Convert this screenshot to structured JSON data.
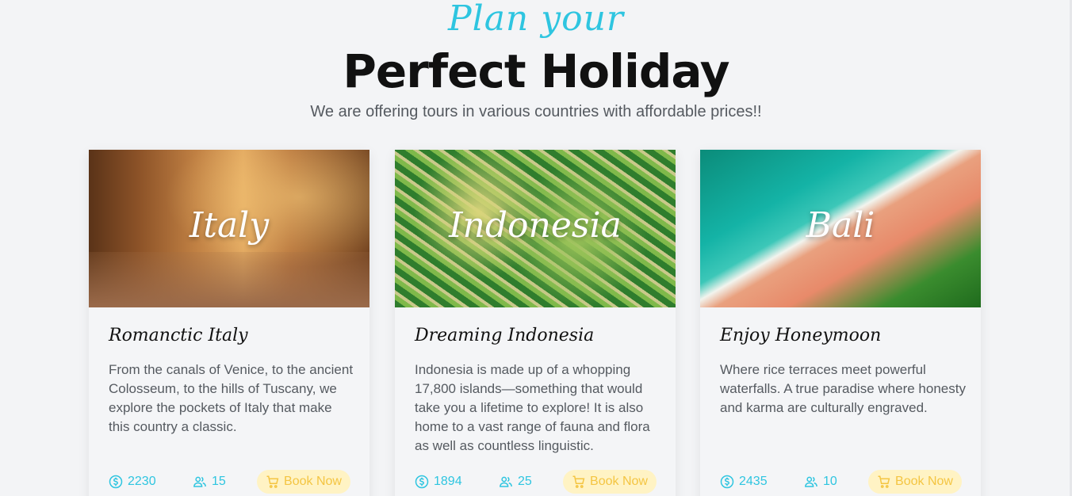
{
  "header": {
    "kicker": "Plan your",
    "title": "Perfect Holiday",
    "subtitle": "We are offering tours in various countries with affordable prices!!"
  },
  "colors": {
    "accent": "#2ec5e0",
    "book_bg": "#fff3c4",
    "book_text": "#f4c542"
  },
  "cards": [
    {
      "image_label": "Italy",
      "title": "Romanctic Italy",
      "description": "From the canals of Venice, to the ancient Colosseum, to the hills of Tuscany, we explore the pockets of Italy that make this country a classic.",
      "price": "2230",
      "people": "15",
      "book_label": "Book Now",
      "price_icon": "dollar-circle-icon",
      "people_icon": "users-icon",
      "book_icon": "cart-icon"
    },
    {
      "image_label": "Indonesia",
      "title": "Dreaming Indonesia",
      "description": "Indonesia is made up of a whopping 17,800 islands—something that would take you a lifetime to explore! It is also home to a vast range of fauna and flora as well as countless linguistic.",
      "price": "1894",
      "people": "25",
      "book_label": "Book Now",
      "price_icon": "dollar-circle-icon",
      "people_icon": "users-icon",
      "book_icon": "cart-icon"
    },
    {
      "image_label": "Bali",
      "title": "Enjoy Honeymoon",
      "description": "Where rice terraces meet powerful waterfalls. A true paradise where honesty and karma are culturally engraved.",
      "price": "2435",
      "people": "10",
      "book_label": "Book Now",
      "price_icon": "dollar-circle-icon",
      "people_icon": "users-icon",
      "book_icon": "cart-icon"
    }
  ]
}
